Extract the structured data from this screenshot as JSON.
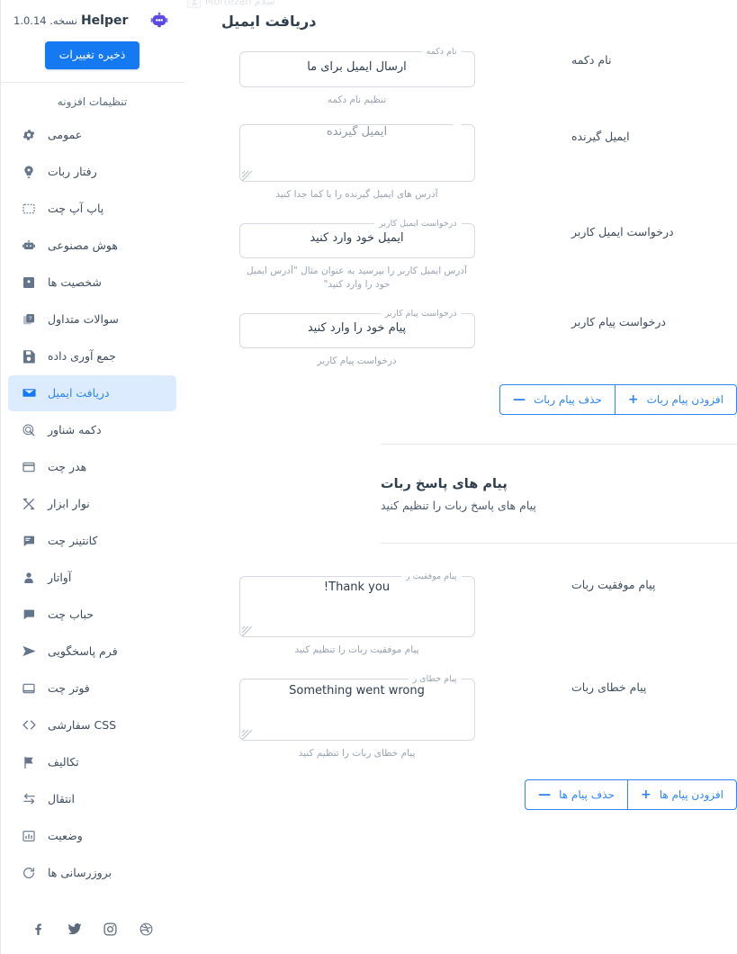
{
  "brand": {
    "name": "Helper",
    "version": "نسخه. 1.0.14",
    "logo_icon": "robot-head-icon",
    "logo_color": "#5b4ae0"
  },
  "sidebar": {
    "save_button": "ذخیره تغییرات",
    "section_title": "تنظیمات افزونه",
    "accent_color": "#1579f2",
    "active_bg": "#dcebfd",
    "items": [
      {
        "label": "عمومی",
        "icon": "gear-icon",
        "active": false
      },
      {
        "label": "رفتار ربات",
        "icon": "bot-behavior-icon",
        "active": false
      },
      {
        "label": "پاپ آپ چت",
        "icon": "popup-icon",
        "active": false
      },
      {
        "label": "هوش مصنوعی",
        "icon": "robot-icon",
        "active": false
      },
      {
        "label": "شخصیت ها",
        "icon": "persona-card-icon",
        "active": false
      },
      {
        "label": "سوالات متداول",
        "icon": "faq-icon",
        "active": false
      },
      {
        "label": "جمع آوری داده",
        "icon": "save-disk-icon",
        "active": false
      },
      {
        "label": "دریافت ایمیل",
        "icon": "envelope-icon",
        "active": true
      },
      {
        "label": "دکمه شناور",
        "icon": "floating-button-icon",
        "active": false
      },
      {
        "label": "هدر چت",
        "icon": "chat-header-icon",
        "active": false
      },
      {
        "label": "نوار ابزار",
        "icon": "toolbar-icon",
        "active": false
      },
      {
        "label": "کانتینر چت",
        "icon": "chat-container-icon",
        "active": false
      },
      {
        "label": "آواتار",
        "icon": "avatar-icon",
        "active": false
      },
      {
        "label": "حباب چت",
        "icon": "chat-bubble-icon",
        "active": false
      },
      {
        "label": "فرم پاسخگویی",
        "icon": "send-icon",
        "active": false
      },
      {
        "label": "فوتر چت",
        "icon": "chat-footer-icon",
        "active": false
      },
      {
        "label": "CSS سفارشی",
        "icon": "code-icon",
        "active": false
      },
      {
        "label": "تکالیف",
        "icon": "flag-icon",
        "active": false
      },
      {
        "label": "انتقال",
        "icon": "transfer-icon",
        "active": false
      },
      {
        "label": "وضعیت",
        "icon": "stats-icon",
        "active": false
      },
      {
        "label": "بروزرسانی ها",
        "icon": "refresh-icon",
        "active": false
      }
    ],
    "social": [
      {
        "icon": "dribbble-icon"
      },
      {
        "icon": "instagram-icon"
      },
      {
        "icon": "twitter-icon"
      },
      {
        "icon": "facebook-icon"
      }
    ]
  },
  "greeting": {
    "text": "سلام Mortezah",
    "avatar_icon": "user-avatar-icon"
  },
  "main": {
    "page_title": "دریافت ایمیل",
    "fields": [
      {
        "label": "نام دکمه",
        "legend": "نام دکمه",
        "value": "ارسال ایمیل برای ما",
        "placeholder": "",
        "helper": "تنظیم نام دکمه",
        "type": "input"
      },
      {
        "label": "ایمیل گیرنده",
        "legend": "",
        "value": "",
        "placeholder": "ایمیل گیرنده",
        "helper": "آدرس های ایمیل گیرنده را با کما جدا کنید",
        "type": "textarea"
      },
      {
        "label": "درخواست ایمیل کاربر",
        "legend": "درخواست ایمیل کاربر",
        "value": "ایمیل خود وارد کنید",
        "placeholder": "",
        "helper": "آدرس ایمیل کاربر را بپرسید به عنوان مثال \"آدرس ایمیل خود را وارد کنید\"",
        "type": "input"
      },
      {
        "label": "درخواست پیام کاربر",
        "legend": "درخواست پیام کاربر",
        "value": "پیام خود را وارد کنید",
        "placeholder": "",
        "helper": "درخواست پیام کاربر",
        "type": "input"
      }
    ],
    "bot_buttons": {
      "add": {
        "label": "افزودن پیام ربات",
        "sign": "+"
      },
      "remove": {
        "label": "حذف پیام ربات",
        "sign": "—"
      }
    },
    "section": {
      "title": "پیام های پاسخ ربات",
      "subtitle": "پیام های پاسخ ربات را تنظیم کنید"
    },
    "response_fields": [
      {
        "label": "پیام موفقیت ربات",
        "legend": "پیام موفقیت ر",
        "value": "Thank you!",
        "helper": "پیام موفقیت ربات را تنظیم کنید",
        "type": "textarea"
      },
      {
        "label": "پیام خطای ربات",
        "legend": "پیام خطای ر",
        "value": "Something went wrong",
        "helper": "پیام خطای ربات را تنظیم کنید",
        "type": "textarea"
      }
    ],
    "message_buttons": {
      "add": {
        "label": "افزودن پیام ها",
        "sign": "+"
      },
      "remove": {
        "label": "حذف پیام ها",
        "sign": "—"
      }
    }
  }
}
